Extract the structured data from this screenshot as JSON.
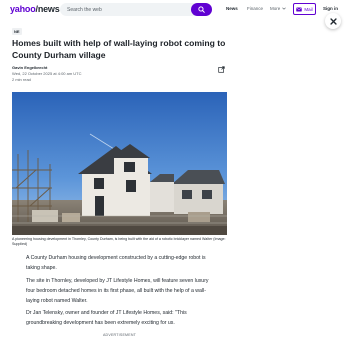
{
  "header": {
    "logo_part1": "yahoo",
    "logo_part2": "/news",
    "search_placeholder": "Search the web",
    "nav": [
      "News",
      "Finance",
      "More"
    ],
    "mail_label": "Mail",
    "signin_label": "Sign in"
  },
  "article": {
    "badge": "NE",
    "title": "Homes built with help of wall-laying robot coming to County Durham village",
    "author": "Gavin Engelbrecht",
    "date": "Wed, 22 October 2025 at 4:00 am UTC",
    "read_time": "2 min read",
    "caption": "A pioneering housing development in Thornley, County Durham, is being built with the aid of a robotic bricklayer named Walter (Image: Supplied)",
    "paragraphs": [
      "A County Durham housing development constructed by a cutting-edge robot is taking shape.",
      "The site in Thornley, developed by JT Lifestyle Homes, will feature seven luxury four bedroom detached homes in its first phase, all built with the help of a wall-laying robot named Walter.",
      "Dr Jan Telensky, owner and founder of JT Lifestyle Homes, said: \"This groundbreaking development has been extremely exciting for us."
    ],
    "ad_label": "ADVERTISEMENT"
  },
  "colors": {
    "brand": "#6001d2",
    "text": "#232a31",
    "muted": "#5b636a"
  },
  "icons": [
    "search-icon",
    "chevron-down-icon",
    "mail-icon",
    "close-icon",
    "share-icon"
  ]
}
